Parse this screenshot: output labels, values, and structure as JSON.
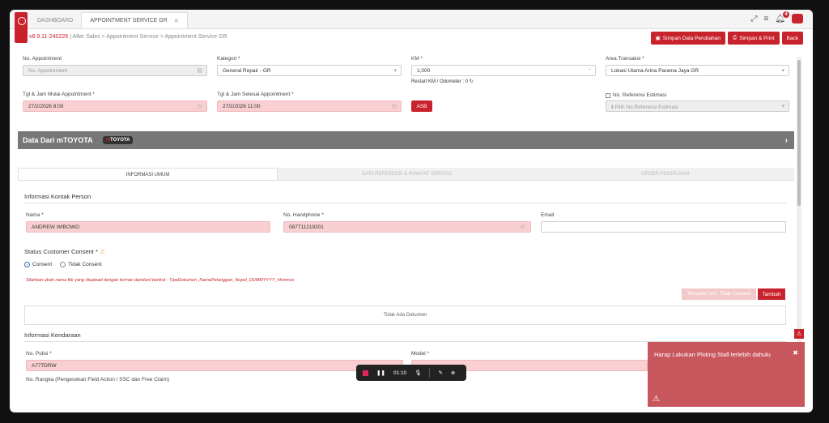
{
  "tabs": [
    {
      "label": "DASHBOARD",
      "active": false
    },
    {
      "label": "APPOINTMENT SERVICE GR",
      "active": true
    }
  ],
  "breadcrumb": {
    "version": "v8.9.11-240226",
    "path": "| After Sales  >  Appointment Service  >  Appointment Service GR"
  },
  "notification_count": "4",
  "actions": {
    "save": "Simpan Data Perubahan",
    "save_print": "Simpan & Print",
    "back": "Back"
  },
  "form": {
    "no_appointment_label": "No. Appointment",
    "no_appointment_placeholder": "No. Appointment",
    "kategori_label": "Kategori *",
    "kategori_value": "General Repair - GR",
    "km_label": "KM *",
    "km_value": "1,000",
    "restart_km": "Restart KM / Odometer : 0",
    "area_label": "Area Transaksi *",
    "area_value": "Lokasi Utama Arina Parama Jaya GR",
    "tgl_mulai_label": "Tgl & Jam Mulai Appointment *",
    "tgl_mulai_value": "27/2/2026 8:00",
    "tgl_selesai_label": "Tgl & Jam Selesai Appointment *",
    "tgl_selesai_value": "27/2/2026 11:00",
    "asb": "ASB",
    "no_ref_label": "No. Referensi Estimasi",
    "no_ref_placeholder": "Pilih No.Referensi Estimasi"
  },
  "mtoyota": {
    "title": "Data Dari mTOYOTA",
    "brand_m": "m",
    "brand_rest": "TOYOTA"
  },
  "subtabs": [
    "INFORMASI UMUM",
    "DATA REFERENSI & RIWAYAT SERVICE",
    "ORDER PEKERJAAN"
  ],
  "kontak": {
    "heading": "Informasi Kontak Person",
    "nama_label": "Nama *",
    "nama_value": "ANDREW WIBOWO",
    "hp_label": "No. Handphone *",
    "hp_value": "087711219201",
    "email_label": "Email",
    "consent_label": "Status Customer Consent *",
    "consent": "Consent",
    "tidak_consent": "Tidak Consent",
    "note": "Silahkan ubah nama file yang diupload dengan format standard berikut : TipeDokumen_NamaPelanggan_Nopol_DDMMYYYY_hhmmss",
    "template_btn": "Template Doc. Tidak Consent",
    "tambah": "Tambah",
    "no_doc": "Tidak Ada Dokumen"
  },
  "kendaraan": {
    "heading": "Informasi Kendaraan",
    "nopol_label": "No. Polisi *",
    "nopol_value": "A777DRW",
    "model_label": "Model *",
    "rangka_label": "No. Rangka (Pengecekan Field Action / SSC dan Free Claim)"
  },
  "toast": {
    "message": "Harap Lakukan Ploting Stall terlebih dahulu"
  },
  "recorder": {
    "time": "01:10"
  },
  "colors": {
    "accent": "#c8232c",
    "toast": "#c8575d",
    "pink_field": "#f8d0d2"
  }
}
